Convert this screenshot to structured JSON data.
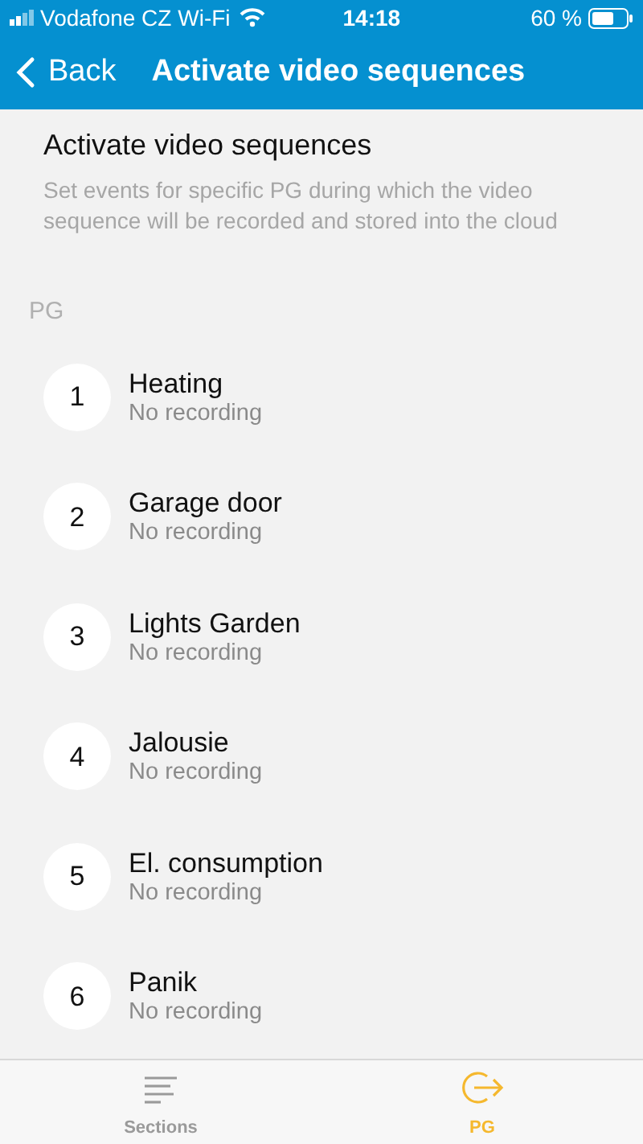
{
  "status_bar": {
    "carrier": "Vodafone CZ Wi-Fi",
    "time": "14:18",
    "battery": "60 %"
  },
  "nav": {
    "back": "Back",
    "title": "Activate video sequences"
  },
  "heading": "Activate video sequences",
  "description": "Set events for specific PG during which the video sequence will be recorded and stored into the cloud",
  "section_label": "PG",
  "items": [
    {
      "number": "1",
      "name": "Heating",
      "status": "No recording"
    },
    {
      "number": "2",
      "name": "Garage door",
      "status": "No recording"
    },
    {
      "number": "3",
      "name": "Lights Garden",
      "status": "No recording"
    },
    {
      "number": "4",
      "name": "Jalousie",
      "status": "No recording"
    },
    {
      "number": "5",
      "name": "El. consumption",
      "status": "No recording"
    },
    {
      "number": "6",
      "name": "Panik",
      "status": "No recording"
    }
  ],
  "tabs": [
    {
      "kind": "sections",
      "label": "Sections",
      "selected": false
    },
    {
      "kind": "pg",
      "label": "PG",
      "selected": true
    }
  ]
}
